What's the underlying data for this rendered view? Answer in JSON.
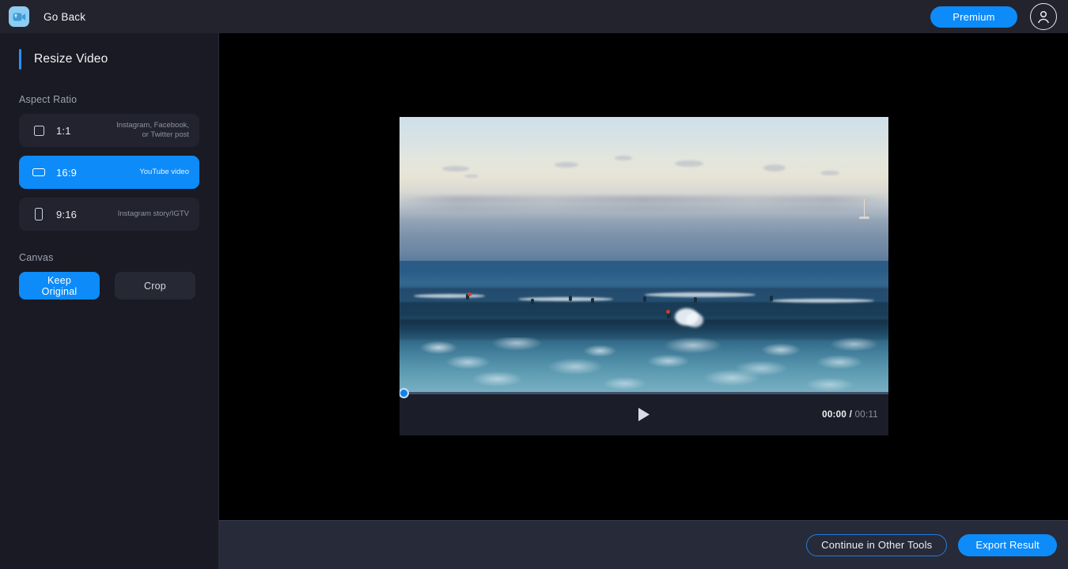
{
  "header": {
    "logo_icon": "video-camera-icon",
    "go_back_label": "Go Back",
    "premium_label": "Premium",
    "avatar_icon": "user-avatar-icon"
  },
  "sidebar": {
    "panel_title": "Resize Video",
    "aspect_section_label": "Aspect Ratio",
    "aspect_options": [
      {
        "ratio": "1:1",
        "description": "Instagram, Facebook,\nor Twitter post",
        "icon": "square-ratio-icon",
        "selected": false
      },
      {
        "ratio": "16:9",
        "description": "YouTube video",
        "icon": "wide-ratio-icon",
        "selected": true
      },
      {
        "ratio": "9:16",
        "description": "Instagram story/IGTV",
        "icon": "tall-ratio-icon",
        "selected": false
      }
    ],
    "canvas_section_label": "Canvas",
    "canvas_options": [
      {
        "label": "Keep Original",
        "selected": true
      },
      {
        "label": "Crop",
        "selected": false
      }
    ]
  },
  "player": {
    "play_icon": "play-icon",
    "current_time": "00:00",
    "time_separator": "/",
    "total_time": "00:11",
    "progress_percent": 0,
    "scrubber_handle_icon": "progress-handle-icon"
  },
  "footer": {
    "continue_label": "Continue in Other Tools",
    "export_label": "Export Result"
  },
  "colors": {
    "accent_blue": "#0d8bf9",
    "header_bg": "#23232e",
    "sidebar_bg": "#191a23",
    "stage_bg": "#000000",
    "bottom_bar_bg": "#272a38",
    "logo_bg": "#8dcdf2"
  }
}
